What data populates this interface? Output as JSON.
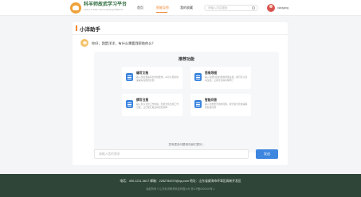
{
  "header": {
    "brand_name": "科羊师故武学习平台",
    "brand_sub": "Learn & Train Your Learning Platform",
    "nav": [
      "首页",
      "智能导师",
      "我的收藏"
    ],
    "active_nav": "智能导师",
    "search_placeholder": "请输入内容搜索",
    "username": "xiaoyang"
  },
  "chat": {
    "title": "小洋助手",
    "greeting": "你好，我是洋洋，有什么需要我帮助的么？"
  },
  "features": {
    "panel_title": "推荐功能",
    "items": [
      {
        "name": "编写文档",
        "desc": "输入所需要编写的文档要求，AI可以帮您快速编写完整的文档",
        "icon": "document-icon"
      },
      {
        "name": "思维导图",
        "desc": "输入需要创建的思维导图主题，我们可以自动生成，让思考变得清晰明了",
        "icon": "mindmap-icon"
      },
      {
        "name": "撰写日报",
        "desc": "输入您今天的工作内容，智能为您生成工作日报，让日常汇报变得轻松简单",
        "icon": "report-icon"
      },
      {
        "name": "智能问答",
        "desc": "输入您想要咨询的问题，我们会为您快速解答各类问题",
        "icon": "qa-icon"
      }
    ],
    "more": "您有更多问题请向我们提问..."
  },
  "input": {
    "placeholder": "请输入您的需求",
    "send_label": "发送"
  },
  "footer": {
    "line1": "电话：400-1211-3617   邮箱：2282784370@qq.com   地址：山东省威海市环翠区高新开发区",
    "line2": "版权所有 © 山东科洋教育科技有限公司 鲁ICP备0000000号-1"
  },
  "colors": {
    "accent_orange": "#f0852b",
    "primary_blue": "#3d86e0",
    "footer_green": "#2f4537"
  }
}
